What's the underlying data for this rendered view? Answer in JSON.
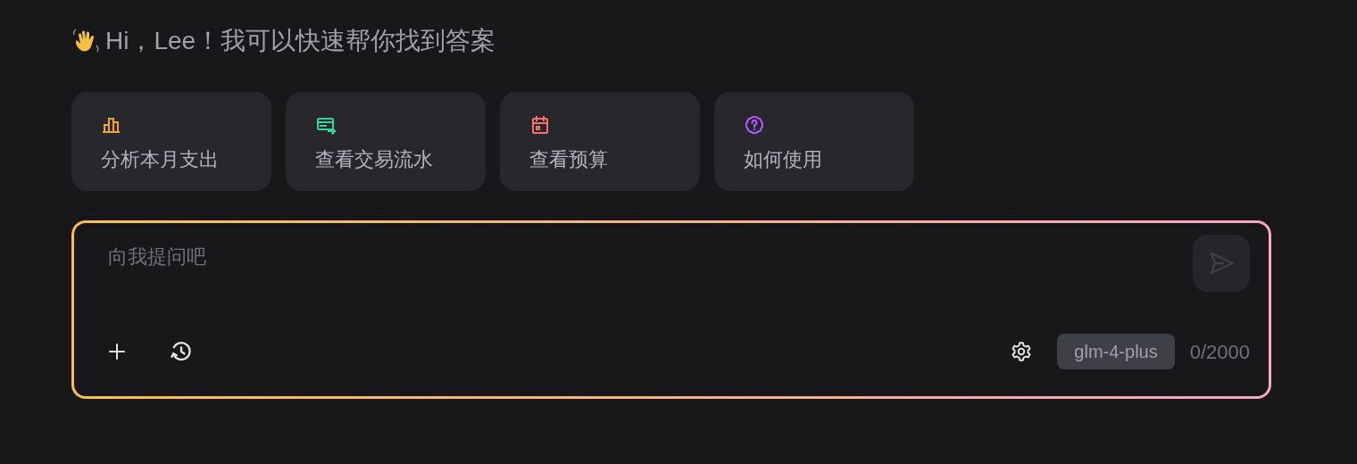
{
  "greeting": "Hi，Lee！我可以快速帮你找到答案",
  "suggestions": [
    {
      "kind": "chart",
      "label": "分析本月支出",
      "color": "#f5a524"
    },
    {
      "kind": "card",
      "label": "查看交易流水",
      "color": "#34d399"
    },
    {
      "kind": "calendar",
      "label": "查看预算",
      "color": "#f87171"
    },
    {
      "kind": "help",
      "label": "如何使用",
      "color": "#a855f7"
    }
  ],
  "composer": {
    "placeholder": "向我提问吧",
    "model": "glm-4-plus",
    "counter": "0/2000",
    "send_disabled": true
  }
}
